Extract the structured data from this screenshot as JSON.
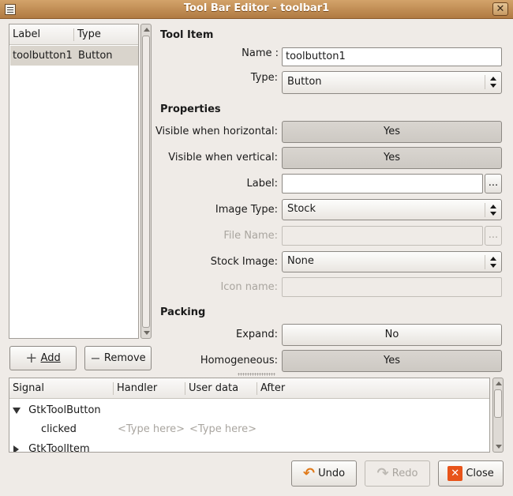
{
  "window": {
    "title": "Tool Bar Editor - toolbar1",
    "close_glyph": "✕"
  },
  "items_list": {
    "headers": [
      "Label",
      "Type"
    ],
    "rows": [
      {
        "label": "toolbutton1",
        "type": "Button"
      }
    ]
  },
  "list_buttons": {
    "add": "Add",
    "remove": "Remove"
  },
  "tool_item": {
    "section": "Tool Item",
    "name_label": "Name :",
    "name_value": "toolbutton1",
    "type_label": "Type:",
    "type_value": "Button"
  },
  "properties": {
    "section": "Properties",
    "visible_horizontal_label": "Visible when horizontal:",
    "visible_horizontal_value": "Yes",
    "visible_vertical_label": "Visible when vertical:",
    "visible_vertical_value": "Yes",
    "label_label": "Label:",
    "label_value": "",
    "ellipsis": "...",
    "image_type_label": "Image Type:",
    "image_type_value": "Stock",
    "file_name_label": "File Name:",
    "file_name_value": "",
    "stock_image_label": "Stock Image:",
    "stock_image_value": "None",
    "icon_name_label": "Icon name:",
    "icon_name_value": ""
  },
  "packing": {
    "section": "Packing",
    "expand_label": "Expand:",
    "expand_value": "No",
    "homogeneous_label": "Homogeneous:",
    "homogeneous_value": "Yes"
  },
  "signals": {
    "headers": [
      "Signal",
      "Handler",
      "User data",
      "After"
    ],
    "group1": "GtkToolButton",
    "signal1": "clicked",
    "handler_placeholder": "<Type here>",
    "userdata_placeholder": "<Type here>",
    "group2": "GtkToolItem"
  },
  "footer": {
    "undo": "Undo",
    "redo": "Redo",
    "close": "Close"
  },
  "colors": {
    "titlebar": "#c08a50",
    "selection": "#d9d4cc",
    "close_icon": "#e8541a",
    "undo_icon": "#e07a1a"
  }
}
